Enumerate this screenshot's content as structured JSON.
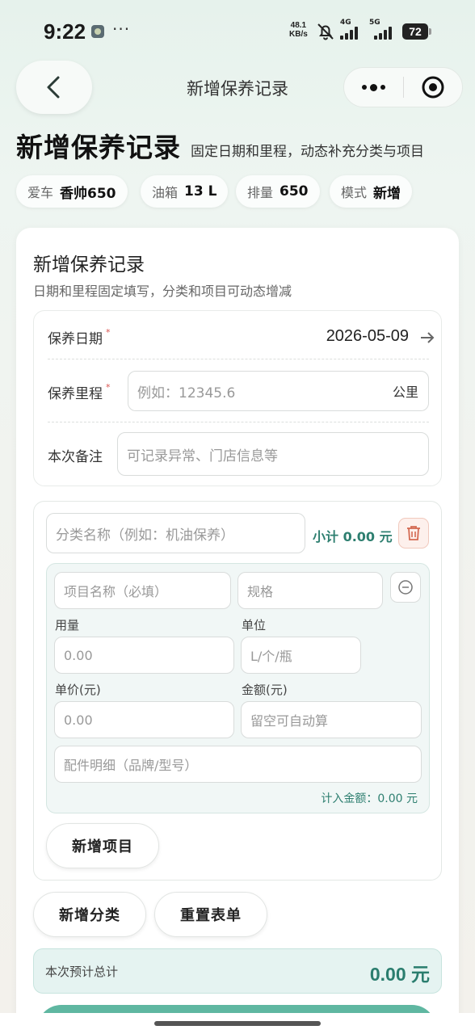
{
  "status_bar": {
    "time": "9:22",
    "more": "···",
    "net_speed_value": "48.1",
    "net_speed_unit": "KB/s",
    "sim1_label": "4G",
    "sim2_label": "5G",
    "battery": "72"
  },
  "nav": {
    "title": "新增保养记录"
  },
  "header": {
    "title": "新增保养记录",
    "subtitle": "固定日期和里程，动态补充分类与项目"
  },
  "chips": [
    {
      "key": "爱车",
      "value": "香帅650"
    },
    {
      "key": "油箱",
      "value": "13 L"
    },
    {
      "key": "排量",
      "value": "650"
    },
    {
      "key": "模式",
      "value": "新增"
    }
  ],
  "form": {
    "title": "新增保养记录",
    "description": "日期和里程固定填写，分类和项目可动态增减",
    "date_label": "保养日期",
    "required_mark": "*",
    "date_value": "2026-05-09",
    "mileage_label": "保养里程",
    "mileage_placeholder": "例如：12345.6",
    "mileage_unit": "公里",
    "note_label": "本次备注",
    "note_placeholder": "可记录异常、门店信息等"
  },
  "category": {
    "name_placeholder": "分类名称（例如：机油保养）",
    "subtotal": "小计 0.00 元",
    "item": {
      "name_placeholder": "项目名称（必填）",
      "spec_placeholder": "规格",
      "qty_label": "用量",
      "qty_placeholder": "0.00",
      "unit_label": "单位",
      "unit_placeholder": "L/个/瓶",
      "price_label": "单价(元)",
      "price_placeholder": "0.00",
      "amount_label": "金额(元)",
      "amount_placeholder": "留空可自动算",
      "parts_placeholder": "配件明细（品牌/型号）",
      "counted_amount": "计入金额：0.00 元"
    },
    "add_item_label": "新增项目"
  },
  "actions": {
    "add_category_label": "新增分类",
    "reset_label": "重置表单"
  },
  "total": {
    "label": "本次预计总计",
    "value": "0.00 元"
  },
  "colors": {
    "accent": "#2e7f70",
    "danger": "#d9534f",
    "submit": "#5fb7a1"
  }
}
